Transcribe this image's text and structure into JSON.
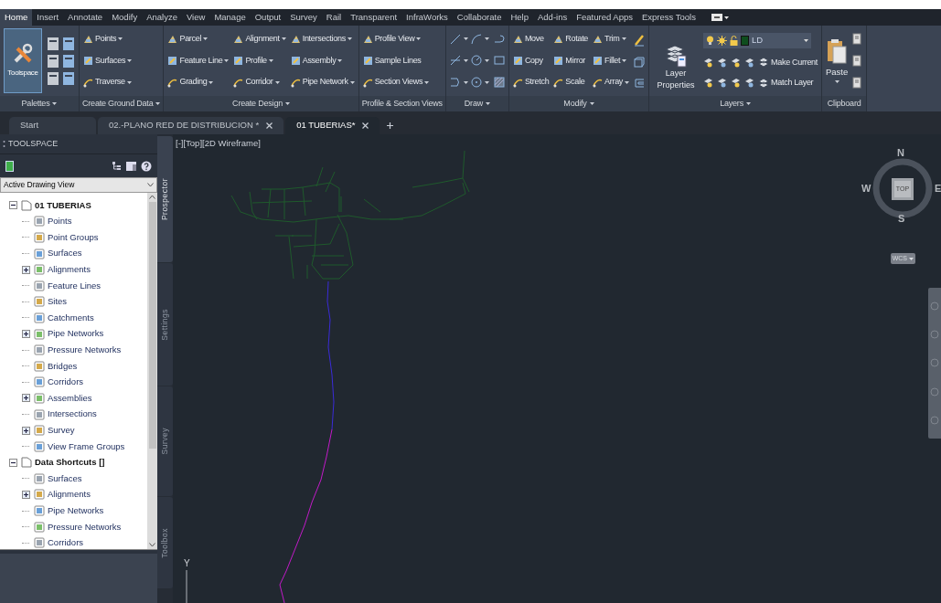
{
  "menu_tabs": [
    {
      "label": "Home",
      "selected": true
    },
    {
      "label": "Insert",
      "selected": false
    },
    {
      "label": "Annotate",
      "selected": false
    },
    {
      "label": "Modify",
      "selected": false
    },
    {
      "label": "Analyze",
      "selected": false
    },
    {
      "label": "View",
      "selected": false
    },
    {
      "label": "Manage",
      "selected": false
    },
    {
      "label": "Output",
      "selected": false
    },
    {
      "label": "Survey",
      "selected": false
    },
    {
      "label": "Rail",
      "selected": false
    },
    {
      "label": "Transparent",
      "selected": false
    },
    {
      "label": "InfraWorks",
      "selected": false
    },
    {
      "label": "Collaborate",
      "selected": false
    },
    {
      "label": "Help",
      "selected": false
    },
    {
      "label": "Add-ins",
      "selected": false
    },
    {
      "label": "Featured Apps",
      "selected": false
    },
    {
      "label": "Express Tools",
      "selected": false
    }
  ],
  "ribbon": {
    "panels": [
      {
        "kind": "palettes",
        "title": "Palettes",
        "dropdown": true,
        "big_button": "Toolspace"
      },
      {
        "kind": "tools",
        "title": "Create Ground Data",
        "dropdown": true,
        "columns": [
          [
            {
              "label": "Points",
              "dropdown": true
            },
            {
              "label": "Surfaces",
              "dropdown": true
            },
            {
              "label": "Traverse",
              "dropdown": true
            }
          ]
        ]
      },
      {
        "kind": "tools",
        "title": "Create Design",
        "dropdown": true,
        "columns": [
          [
            {
              "label": "Parcel",
              "dropdown": true
            },
            {
              "label": "Feature Line",
              "dropdown": true
            },
            {
              "label": "Grading",
              "dropdown": true
            }
          ],
          [
            {
              "label": "Alignment",
              "dropdown": true
            },
            {
              "label": "Profile",
              "dropdown": true
            },
            {
              "label": "Corridor",
              "dropdown": true
            }
          ],
          [
            {
              "label": "Intersections",
              "dropdown": true
            },
            {
              "label": "Assembly",
              "dropdown": true
            },
            {
              "label": "Pipe Network",
              "dropdown": true
            }
          ]
        ]
      },
      {
        "kind": "tools",
        "title": "Profile & Section Views",
        "dropdown": false,
        "columns": [
          [
            {
              "label": "Profile View",
              "dropdown": true
            },
            {
              "label": "Sample Lines",
              "dropdown": false
            },
            {
              "label": "Section Views",
              "dropdown": true
            }
          ]
        ]
      },
      {
        "kind": "draw",
        "title": "Draw",
        "dropdown": true
      },
      {
        "kind": "modify",
        "title": "Modify",
        "dropdown": true,
        "columns": [
          [
            {
              "label": "Move",
              "dropdown": false
            },
            {
              "label": "Copy",
              "dropdown": false
            },
            {
              "label": "Stretch",
              "dropdown": false
            }
          ],
          [
            {
              "label": "Rotate",
              "dropdown": false
            },
            {
              "label": "Mirror",
              "dropdown": false
            },
            {
              "label": "Scale",
              "dropdown": false
            }
          ],
          [
            {
              "label": "Trim",
              "dropdown": true
            },
            {
              "label": "Fillet",
              "dropdown": true
            },
            {
              "label": "Array",
              "dropdown": true
            }
          ]
        ]
      },
      {
        "kind": "layers",
        "title": "Layers",
        "dropdown": true,
        "big_button": "Layer Properties",
        "layer": "LD",
        "actions": [
          "Make Current",
          "Match Layer"
        ]
      },
      {
        "kind": "clipboard",
        "title": "Clipboard",
        "dropdown": false,
        "big_button": "Paste"
      }
    ]
  },
  "document_tabs": [
    {
      "label": "Start",
      "selected": false,
      "closable": false
    },
    {
      "label": "02.-PLANO RED DE DISTRIBUCION *",
      "selected": false,
      "closable": true
    },
    {
      "label": "01 TUBERIAS*",
      "selected": true,
      "closable": true
    }
  ],
  "toolspace": {
    "title": "TOOLSPACE",
    "view_selector": "Active Drawing View",
    "tree": [
      {
        "label": "01 TUBERIAS",
        "expanded": true,
        "children": [
          {
            "label": "Points"
          },
          {
            "label": "Point Groups"
          },
          {
            "label": "Surfaces"
          },
          {
            "label": "Alignments",
            "expanded": false
          },
          {
            "label": "Feature Lines"
          },
          {
            "label": "Sites"
          },
          {
            "label": "Catchments"
          },
          {
            "label": "Pipe Networks",
            "expanded": false
          },
          {
            "label": "Pressure Networks"
          },
          {
            "label": "Bridges"
          },
          {
            "label": "Corridors"
          },
          {
            "label": "Assemblies",
            "expanded": false
          },
          {
            "label": "Intersections"
          },
          {
            "label": "Survey",
            "expanded": false
          },
          {
            "label": "View Frame Groups"
          }
        ]
      },
      {
        "label": "Data Shortcuts []",
        "expanded": true,
        "children": [
          {
            "label": "Surfaces"
          },
          {
            "label": "Alignments",
            "expanded": false
          },
          {
            "label": "Pipe Networks"
          },
          {
            "label": "Pressure Networks"
          },
          {
            "label": "Corridors"
          }
        ]
      }
    ],
    "tabs": [
      {
        "label": "Prospector",
        "selected": true
      },
      {
        "label": "Settings",
        "selected": false
      },
      {
        "label": "Survey",
        "selected": false
      },
      {
        "label": "Toolbox",
        "selected": false
      }
    ]
  },
  "viewport": {
    "label": "[-][Top][2D Wireframe]",
    "viewcube": {
      "face": "TOP",
      "north": "N",
      "south": "S",
      "east": "E",
      "west": "W"
    },
    "ucs": "WCS",
    "axis": "Y"
  }
}
